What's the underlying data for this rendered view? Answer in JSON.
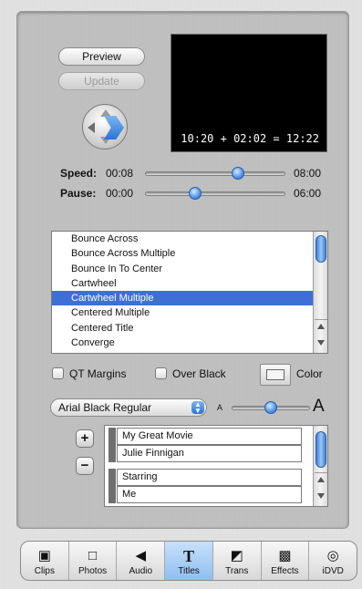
{
  "buttons": {
    "preview": "Preview",
    "update": "Update"
  },
  "preview_monitor": {
    "timecode": "10:20 + 02:02 = 12:22"
  },
  "speed": {
    "label": "Speed:",
    "value": "00:08",
    "max": "08:00",
    "level": 0.66
  },
  "pause": {
    "label": "Pause:",
    "value": "00:00",
    "max": "06:00",
    "level": 0.36
  },
  "titles_list": {
    "items": [
      "Bounce Across",
      "Bounce Across Multiple",
      "Bounce In To Center",
      "Cartwheel",
      "Cartwheel Multiple",
      "Centered Multiple",
      "Centered Title",
      "Converge"
    ],
    "selected_index": 4
  },
  "options": {
    "qt_margins": "QT Margins",
    "over_black": "Over Black",
    "color": "Color"
  },
  "font": {
    "selected": "Arial Black Regular",
    "small_a": "A",
    "big_a": "A",
    "size_level": 0.5
  },
  "text_pairs": [
    {
      "line1": "My Great Movie",
      "line2": "Julie Finnigan"
    },
    {
      "line1": "Starring",
      "line2": "Me"
    }
  ],
  "pair_controls": {
    "add": "+",
    "remove": "−"
  },
  "toolbar": {
    "items": [
      {
        "label": "Clips",
        "icon": "clips-icon",
        "glyph": "▣"
      },
      {
        "label": "Photos",
        "icon": "photos-icon",
        "glyph": "□"
      },
      {
        "label": "Audio",
        "icon": "speaker-icon",
        "glyph": "◀"
      },
      {
        "label": "Titles",
        "icon": "titles-icon",
        "glyph": "T"
      },
      {
        "label": "Trans",
        "icon": "transition-icon",
        "glyph": "◩"
      },
      {
        "label": "Effects",
        "icon": "effects-icon",
        "glyph": "▩"
      },
      {
        "label": "iDVD",
        "icon": "dvd-icon",
        "glyph": "◎"
      }
    ],
    "active": "Titles"
  },
  "colors": {
    "accent": "#3d6fd6",
    "monitor": "#000000",
    "timecode": "#ffffff"
  }
}
